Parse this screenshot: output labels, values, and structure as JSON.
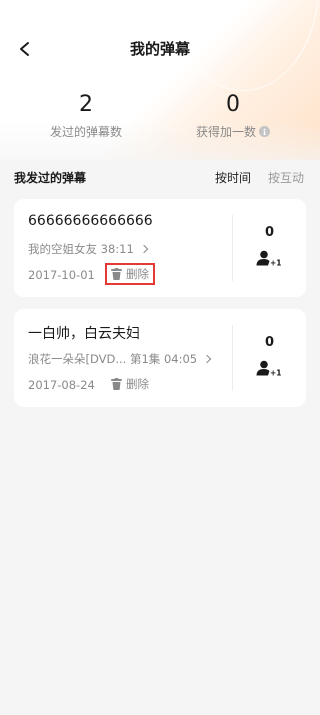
{
  "header": {
    "title": "我的弹幕",
    "back_icon": "back-arrow-icon"
  },
  "stats": {
    "sent": {
      "value": "2",
      "label": "发过的弹幕数"
    },
    "likes": {
      "value": "0",
      "label": "获得加一数",
      "info_icon": "info-icon",
      "info_glyph": "i"
    }
  },
  "section": {
    "title": "我发过的弹幕",
    "sort_tabs": [
      {
        "label": "按时间",
        "active": true
      },
      {
        "label": "按互动",
        "active": false
      }
    ]
  },
  "danmaku": [
    {
      "text": "66666666666666",
      "source": "我的空姐女友  38:11",
      "date": "2017-10-01",
      "delete_label": "删除",
      "plus_count": "0",
      "plus_label": "+1",
      "highlighted": true
    },
    {
      "text": "一白帅，白云夫妇",
      "source": "浪花一朵朵[DVD... 第1集 04:05",
      "date": "2017-08-24",
      "delete_label": "删除",
      "plus_count": "0",
      "plus_label": "+1",
      "highlighted": false
    }
  ],
  "colors": {
    "background": "#f5f5f5",
    "card": "#ffffff",
    "highlight_border": "#e53935",
    "muted_text": "#8a8a8a"
  }
}
